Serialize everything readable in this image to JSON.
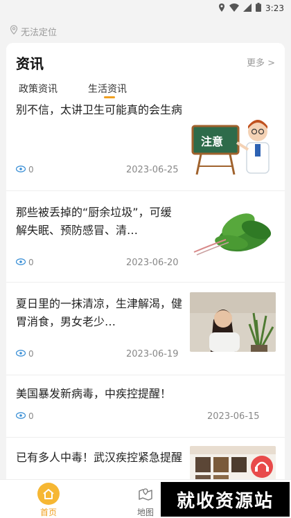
{
  "status_bar": {
    "time": "3:23"
  },
  "location": {
    "text": "无法定位"
  },
  "news": {
    "title": "资讯",
    "more_label": "更多 >",
    "tabs": [
      {
        "label": "政策资讯"
      },
      {
        "label": "生活资讯"
      }
    ],
    "items": [
      {
        "title": "别不信，太讲卫生可能真的会生病",
        "views": "0",
        "date": "2023-06-25",
        "thumb_text": "注意"
      },
      {
        "title": "那些被丢掉的“厨余垃圾”，可缓解失眠、预防感冒、清…",
        "views": "0",
        "date": "2023-06-20"
      },
      {
        "title": "夏日里的一抹清凉，生津解渴，健胃消食，男女老少…",
        "views": "0",
        "date": "2023-06-19"
      },
      {
        "title": "美国暴发新病毒，中疾控提醒！",
        "views": "0",
        "date": "2023-06-15"
      },
      {
        "title": "已有多人中毒！武汉疾控紧急提醒",
        "views": "",
        "date": ""
      }
    ]
  },
  "bottom_nav": {
    "home_label": "首页",
    "map_label": "地图"
  },
  "watermark": {
    "text": "就收资源站"
  },
  "colors": {
    "accent": "#f0a020",
    "eye": "#3a8fd6",
    "chalkboard": "#2e6b4a"
  }
}
